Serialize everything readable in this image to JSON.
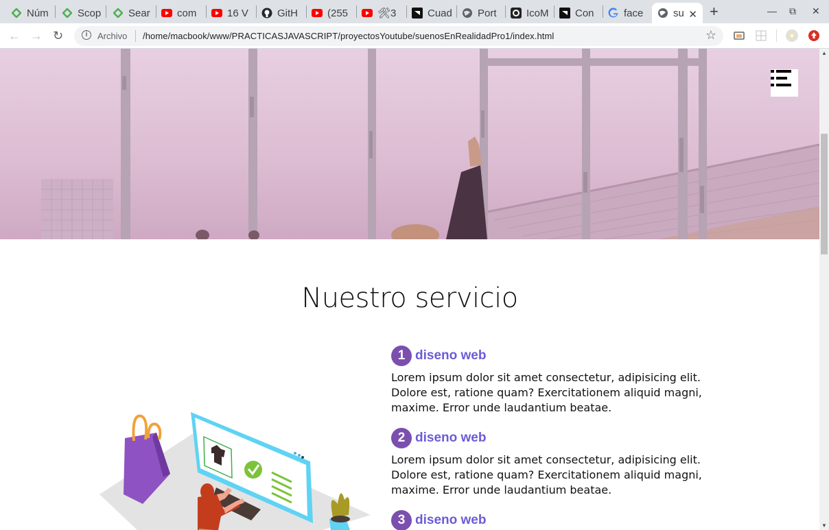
{
  "tabs": [
    {
      "title": "Núm",
      "icon": "green-diamond-icon"
    },
    {
      "title": "Scop",
      "icon": "green-diamond-icon"
    },
    {
      "title": "Sear",
      "icon": "green-diamond-icon"
    },
    {
      "title": "com",
      "icon": "youtube-icon"
    },
    {
      "title": "16 V",
      "icon": "youtube-icon"
    },
    {
      "title": "GitH",
      "icon": "github-icon"
    },
    {
      "title": "(255",
      "icon": "youtube-icon"
    },
    {
      "title": "🛠3",
      "icon": "youtube-icon"
    },
    {
      "title": "Cuad",
      "icon": "codepen-icon"
    },
    {
      "title": "Port",
      "icon": "globe-icon"
    },
    {
      "title": "IcoM",
      "icon": "icomoon-icon"
    },
    {
      "title": "Con",
      "icon": "codepen-icon"
    },
    {
      "title": "face",
      "icon": "google-icon"
    },
    {
      "title": "su",
      "icon": "globe-icon",
      "active": true
    }
  ],
  "toolbar": {
    "scheme_label": "Archivo",
    "url": "/home/macbook/www/PRACTICASJAVASCRIPT/proyectosYoutube/suenosEnRealidadPro1/index.html"
  },
  "page": {
    "section_title": "Nuestro servicio",
    "services": [
      {
        "number": "1",
        "title": "diseno web",
        "description": "Lorem ipsum dolor sit amet consectetur, adipisicing elit. Dolore est, ratione quam? Exercitationem aliquid magni, maxime. Error unde laudantium beatae."
      },
      {
        "number": "2",
        "title": "diseno web",
        "description": "Lorem ipsum dolor sit amet consectetur, adipisicing elit. Dolore est, ratione quam? Exercitationem aliquid magni, maxime. Error unde laudantium beatae."
      },
      {
        "number": "3",
        "title": "diseno web",
        "description": ""
      }
    ]
  },
  "colors": {
    "accent_purple": "#7b4fae",
    "service_title": "#6b5bd6",
    "hero_tint": "#e8cfe2"
  }
}
